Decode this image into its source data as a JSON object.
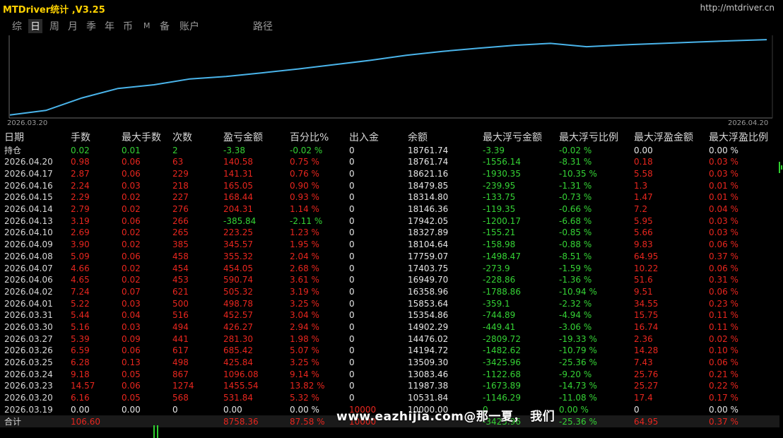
{
  "app": {
    "title": "MTDriver统计 ,V3.25",
    "url": "http://mtdriver.cn"
  },
  "tabs": [
    {
      "label": "综",
      "active": false
    },
    {
      "label": "日",
      "active": true
    },
    {
      "label": "周",
      "active": false
    },
    {
      "label": "月",
      "active": false
    },
    {
      "label": "季",
      "active": false
    },
    {
      "label": "年",
      "active": false
    },
    {
      "label": "币",
      "active": false
    },
    {
      "label": "M",
      "active": false
    },
    {
      "label": "备",
      "active": false
    },
    {
      "label": "账户",
      "active": false
    },
    {
      "label": "路径",
      "active": false
    }
  ],
  "chart_data": {
    "type": "line",
    "x_start_label": "2026.03.20",
    "x_end_label": "2026.04.20",
    "x": [
      "2026.03.19",
      "2026.03.20",
      "2026.03.23",
      "2026.03.24",
      "2026.03.25",
      "2026.03.26",
      "2026.03.27",
      "2026.03.30",
      "2026.03.31",
      "2026.04.01",
      "2026.04.02",
      "2026.04.06",
      "2026.04.07",
      "2026.04.08",
      "2026.04.09",
      "2026.04.10",
      "2026.04.13",
      "2026.04.14",
      "2026.04.15",
      "2026.04.16",
      "2026.04.17",
      "2026.04.20"
    ],
    "series": [
      {
        "values": [
          10000.0,
          10531.84,
          11987.38,
          13083.46,
          13509.3,
          14194.72,
          14476.02,
          14902.29,
          15354.86,
          15853.64,
          16358.96,
          16949.7,
          17403.75,
          17759.07,
          18104.64,
          18327.89,
          17942.05,
          18146.36,
          18314.8,
          18479.85,
          18621.16,
          18761.74
        ]
      }
    ],
    "color": "#4ab4ea"
  },
  "table": {
    "headers": [
      "日期",
      "手数",
      "最大手数",
      "次数",
      "盈亏金额",
      "百分比%",
      "出入金",
      "余额",
      "最大浮亏金额",
      "最大浮亏比例",
      "最大浮盈金额",
      "最大浮盈比例"
    ],
    "position_row": [
      "持仓",
      "0.02",
      "0.01",
      "2",
      "-3.38",
      "-0.02 %",
      "0",
      "18761.74",
      "-3.39",
      "-0.02 %",
      "0.00",
      "0.00 %"
    ],
    "rows": [
      [
        "2026.04.20",
        "0.98",
        "0.06",
        "63",
        "140.58",
        "0.75 %",
        "0",
        "18761.74",
        "-1556.14",
        "-8.31 %",
        "0.18",
        "0.03 %"
      ],
      [
        "2026.04.17",
        "2.87",
        "0.06",
        "229",
        "141.31",
        "0.76 %",
        "0",
        "18621.16",
        "-1930.35",
        "-10.35 %",
        "5.58",
        "0.03 %"
      ],
      [
        "2026.04.16",
        "2.24",
        "0.03",
        "218",
        "165.05",
        "0.90 %",
        "0",
        "18479.85",
        "-239.95",
        "-1.31 %",
        "1.3",
        "0.01 %"
      ],
      [
        "2026.04.15",
        "2.29",
        "0.02",
        "227",
        "168.44",
        "0.93 %",
        "0",
        "18314.80",
        "-133.75",
        "-0.73 %",
        "1.47",
        "0.01 %"
      ],
      [
        "2026.04.14",
        "2.79",
        "0.02",
        "276",
        "204.31",
        "1.14 %",
        "0",
        "18146.36",
        "-119.35",
        "-0.66 %",
        "7.2",
        "0.04 %"
      ],
      [
        "2026.04.13",
        "3.19",
        "0.06",
        "266",
        "-385.84",
        "-2.11 %",
        "0",
        "17942.05",
        "-1200.17",
        "-6.68 %",
        "5.95",
        "0.03 %"
      ],
      [
        "2026.04.10",
        "2.69",
        "0.02",
        "265",
        "223.25",
        "1.23 %",
        "0",
        "18327.89",
        "-155.21",
        "-0.85 %",
        "5.66",
        "0.03 %"
      ],
      [
        "2026.04.09",
        "3.90",
        "0.02",
        "385",
        "345.57",
        "1.95 %",
        "0",
        "18104.64",
        "-158.98",
        "-0.88 %",
        "9.83",
        "0.06 %"
      ],
      [
        "2026.04.08",
        "5.09",
        "0.06",
        "458",
        "355.32",
        "2.04 %",
        "0",
        "17759.07",
        "-1498.47",
        "-8.51 %",
        "64.95",
        "0.37 %"
      ],
      [
        "2026.04.07",
        "4.66",
        "0.02",
        "454",
        "454.05",
        "2.68 %",
        "0",
        "17403.75",
        "-273.9",
        "-1.59 %",
        "10.22",
        "0.06 %"
      ],
      [
        "2026.04.06",
        "4.65",
        "0.02",
        "453",
        "590.74",
        "3.61 %",
        "0",
        "16949.70",
        "-228.86",
        "-1.36 %",
        "51.6",
        "0.31 %"
      ],
      [
        "2026.04.02",
        "7.24",
        "0.07",
        "621",
        "505.32",
        "3.19 %",
        "0",
        "16358.96",
        "-1788.86",
        "-10.94 %",
        "9.51",
        "0.06 %"
      ],
      [
        "2026.04.01",
        "5.22",
        "0.03",
        "500",
        "498.78",
        "3.25 %",
        "0",
        "15853.64",
        "-359.1",
        "-2.32 %",
        "34.55",
        "0.23 %"
      ],
      [
        "2026.03.31",
        "5.44",
        "0.04",
        "516",
        "452.57",
        "3.04 %",
        "0",
        "15354.86",
        "-744.89",
        "-4.94 %",
        "15.75",
        "0.11 %"
      ],
      [
        "2026.03.30",
        "5.16",
        "0.03",
        "494",
        "426.27",
        "2.94 %",
        "0",
        "14902.29",
        "-449.41",
        "-3.06 %",
        "16.74",
        "0.11 %"
      ],
      [
        "2026.03.27",
        "5.39",
        "0.09",
        "441",
        "281.30",
        "1.98 %",
        "0",
        "14476.02",
        "-2809.72",
        "-19.33 %",
        "2.36",
        "0.02 %"
      ],
      [
        "2026.03.26",
        "6.59",
        "0.06",
        "617",
        "685.42",
        "5.07 %",
        "0",
        "14194.72",
        "-1482.62",
        "-10.79 %",
        "14.28",
        "0.10 %"
      ],
      [
        "2026.03.25",
        "6.28",
        "0.13",
        "498",
        "425.84",
        "3.25 %",
        "0",
        "13509.30",
        "-3425.96",
        "-25.36 %",
        "7.43",
        "0.06 %"
      ],
      [
        "2026.03.24",
        "9.18",
        "0.05",
        "867",
        "1096.08",
        "9.14 %",
        "0",
        "13083.46",
        "-1122.68",
        "-9.20 %",
        "25.76",
        "0.21 %"
      ],
      [
        "2026.03.23",
        "14.57",
        "0.06",
        "1274",
        "1455.54",
        "13.82 %",
        "0",
        "11987.38",
        "-1673.89",
        "-14.73 %",
        "25.27",
        "0.22 %"
      ],
      [
        "2026.03.20",
        "6.16",
        "0.05",
        "568",
        "531.84",
        "5.32 %",
        "0",
        "10531.84",
        "-1146.29",
        "-11.08 %",
        "17.4",
        "0.17 %"
      ],
      [
        "2026.03.19",
        "0.00",
        "0.00",
        "0",
        "0.00",
        "0.00 %",
        "10000",
        "10000.00",
        "0",
        "0.00 %",
        "0",
        "0.00 %"
      ]
    ],
    "total_row": [
      "合计",
      "106.60",
      "",
      "",
      "8758.36",
      "87.58 %",
      "10000",
      "",
      "-3425.96",
      "-25.36 %",
      "64.95",
      "0.37 %"
    ]
  },
  "watermark": "www.eazhijia.com@那一夏， 我们"
}
